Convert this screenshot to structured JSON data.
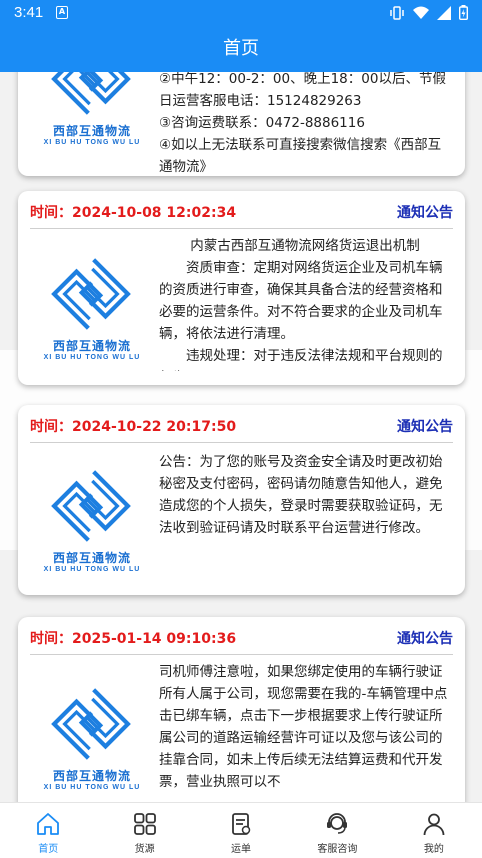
{
  "status_bar": {
    "time": "3:41",
    "sim_label": "A",
    "icons": [
      "vibrate-icon",
      "wifi-icon",
      "signal-icon",
      "battery-icon"
    ]
  },
  "app_bar": {
    "title": "首页"
  },
  "logo": {
    "name_cn": "西部互通物流",
    "name_py": "XI BU HU TONG WU LU"
  },
  "notices": [
    {
      "time": "",
      "tag": "",
      "paragraphs": [
        "②中午12：00-2：00、晚上18：00以后、节假日运营客服电话：15124829263",
        "③咨询运费联系：0472-8886116",
        "④如以上无法联系可直接搜索微信搜索《西部互通物流》"
      ]
    },
    {
      "time": "时间：2024-10-08 12:02:34",
      "tag": "通知公告",
      "title": "内蒙古西部互通物流网络货运退出机制",
      "paragraphs": [
        "资质审查：定期对网络货运企业及司机车辆的资质进行审查，确保其具备合法的经营资格和必要的运营条件。对不符合要求的企业及司机车辆，将依法进行清理。",
        "违规处理：对于违反法律法规和平台规则的行为"
      ]
    },
    {
      "time": "时间：2024-10-22 20:17:50",
      "tag": "通知公告",
      "paragraphs": [
        "公告：为了您的账号及资金安全请及时更改初始秘密及支付密码，密码请勿随意告知他人，避免造成您的个人损失，登录时需要获取验证码，无法收到验证码请及时联系平台运营进行修改。"
      ]
    },
    {
      "time": "时间：2025-01-14 09:10:36",
      "tag": "通知公告",
      "paragraphs": [
        "司机师傅注意啦，如果您绑定使用的车辆行驶证所有人属于公司，现您需要在我的-车辆管理中点击已绑车辆，点击下一步根据要求上传行驶证所属公司的道路运输经营许可证以及您与该公司的挂靠合同，如未上传后续无法结算运费和代开发票，营业执照可以不"
      ]
    }
  ],
  "tab_bar": {
    "items": [
      {
        "label": "首页",
        "icon": "home-icon",
        "active": true
      },
      {
        "label": "货源",
        "icon": "grid-icon",
        "active": false
      },
      {
        "label": "运单",
        "icon": "waybill-icon",
        "active": false
      },
      {
        "label": "客服咨询",
        "icon": "headset-icon",
        "active": false
      },
      {
        "label": "我的",
        "icon": "person-icon",
        "active": false
      }
    ]
  },
  "colors": {
    "primary": "#1a8cf5",
    "time_red": "#e31b1b",
    "tag_blue": "#1c2fb5",
    "logo_blue": "#1a6fd1"
  }
}
